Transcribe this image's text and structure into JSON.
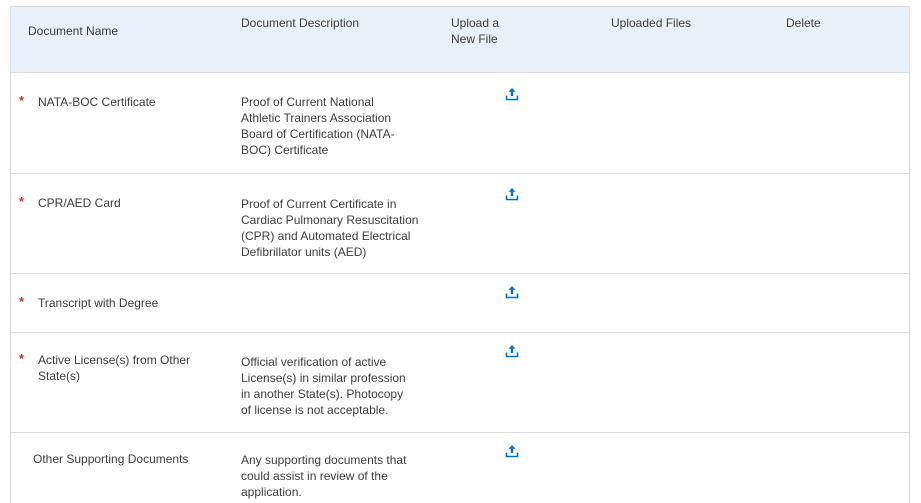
{
  "header": {
    "document_name": "Document Name",
    "document_description": "Document Description",
    "upload_line1": "Upload a",
    "upload_line2": "New File",
    "uploaded_files": "Uploaded Files",
    "delete": "Delete"
  },
  "required_marker": "*",
  "colors": {
    "header_bg": "#e8f0fa",
    "required": "#c23934",
    "upload_icon": "#0070d2",
    "border": "#dddbda"
  },
  "rows": [
    {
      "required": true,
      "name": [
        "NATA-BOC Certificate"
      ],
      "description": [
        "Proof of Current National",
        "Athletic Trainers Association",
        "Board of Certification (NATA-",
        "BOC) Certificate"
      ],
      "upload_icon": "upload-icon"
    },
    {
      "required": true,
      "name": [
        "CPR/AED Card"
      ],
      "description": [
        "Proof of Current Certificate in",
        "Cardiac Pulmonary Resuscitation",
        "(CPR) and Automated Electrical",
        "Defibrillator units (AED)"
      ],
      "upload_icon": "upload-icon"
    },
    {
      "required": true,
      "name": [
        "Transcript with Degree"
      ],
      "description": [],
      "upload_icon": "upload-icon"
    },
    {
      "required": true,
      "name": [
        "Active License(s) from Other",
        "State(s)"
      ],
      "description": [
        "Official verification of active",
        "License(s) in similar profession",
        "in another State(s). Photocopy",
        "of license is not acceptable."
      ],
      "upload_icon": "upload-icon"
    },
    {
      "required": false,
      "name": [
        "Other Supporting Documents"
      ],
      "description": [
        "Any supporting documents that",
        "could assist in review of the",
        "application."
      ],
      "upload_icon": "upload-icon"
    }
  ]
}
